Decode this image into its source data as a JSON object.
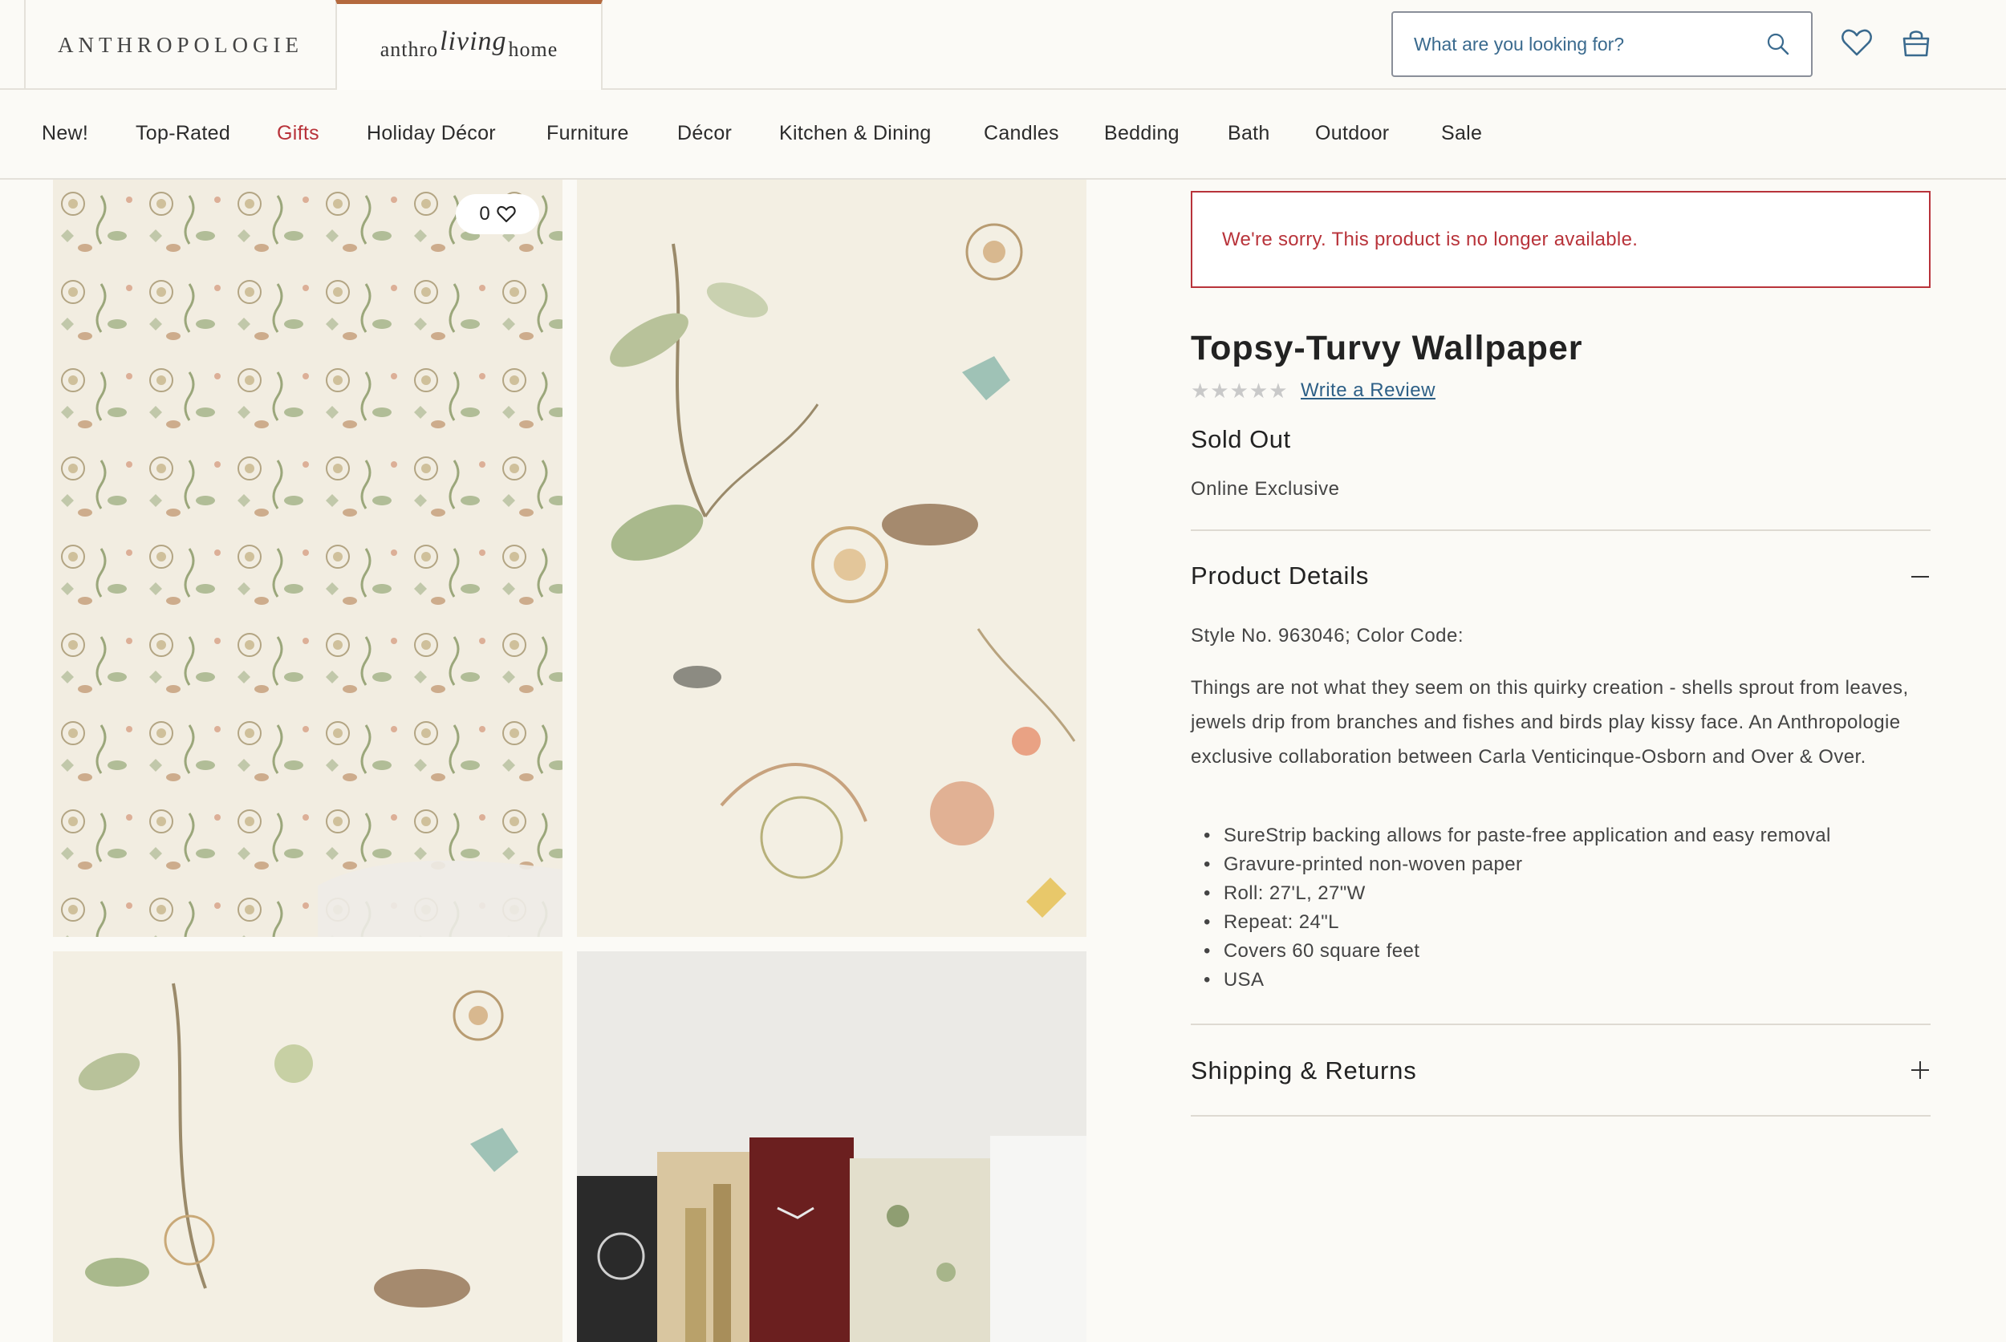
{
  "header": {
    "brand_primary": "ANTHROPOLOGIE",
    "brand_secondary_left": "anthro",
    "brand_secondary_script": "living",
    "brand_secondary_right": "home",
    "search_placeholder": "What are you looking for?",
    "accent_color": "#b4693e"
  },
  "nav": {
    "items": [
      {
        "label": "New!"
      },
      {
        "label": "Top-Rated"
      },
      {
        "label": "Gifts",
        "highlight": true,
        "color": "#b8333a"
      },
      {
        "label": "Holiday Décor"
      },
      {
        "label": "Furniture"
      },
      {
        "label": "Décor"
      },
      {
        "label": "Kitchen & Dining"
      },
      {
        "label": "Candles"
      },
      {
        "label": "Bedding"
      },
      {
        "label": "Bath"
      },
      {
        "label": "Outdoor"
      },
      {
        "label": "Sale"
      }
    ]
  },
  "gallery": {
    "favorite_count": "0"
  },
  "product": {
    "unavailable_message": "We're sorry. This product is no longer available.",
    "title": "Topsy-Turvy Wallpaper",
    "rating_stars": "★★★★★",
    "rating_value": 0,
    "review_link": "Write a Review",
    "status": "Sold Out",
    "badge": "Online Exclusive",
    "details_heading": "Product Details",
    "style_line": "Style No. 963046; Color Code:",
    "description": "Things are not what they seem on this quirky creation - shells sprout from leaves, jewels drip from branches and fishes and birds play kissy face. An Anthropologie exclusive collaboration between Carla Venticinque-Osborn and Over & Over.",
    "features": [
      "SureStrip backing allows for paste-free application and easy removal",
      "Gravure-printed non-woven paper",
      "Roll: 27'L, 27\"W",
      "Repeat: 24\"L",
      "Covers 60 square feet",
      "USA"
    ],
    "shipping_heading": "Shipping & Returns",
    "alert_color": "#b8333a"
  }
}
